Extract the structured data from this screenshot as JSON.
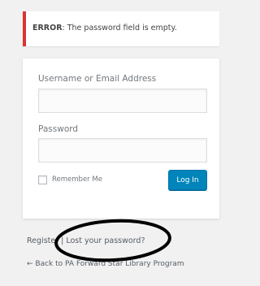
{
  "error": {
    "label": "ERROR",
    "message": ": The password field is empty."
  },
  "form": {
    "username_label": "Username or Email Address",
    "username_value": "",
    "password_label": "Password",
    "password_value": "",
    "remember_label": "Remember Me",
    "remember_checked": false,
    "login_button": "Log In"
  },
  "nav": {
    "register": "Register",
    "separator": "|",
    "lost_password": "Lost your password?",
    "back_to_site": "← Back to PA Forward Star Library Program"
  },
  "colors": {
    "error_border": "#dc3232",
    "button": "#0085ba",
    "annotation": "#000000"
  }
}
